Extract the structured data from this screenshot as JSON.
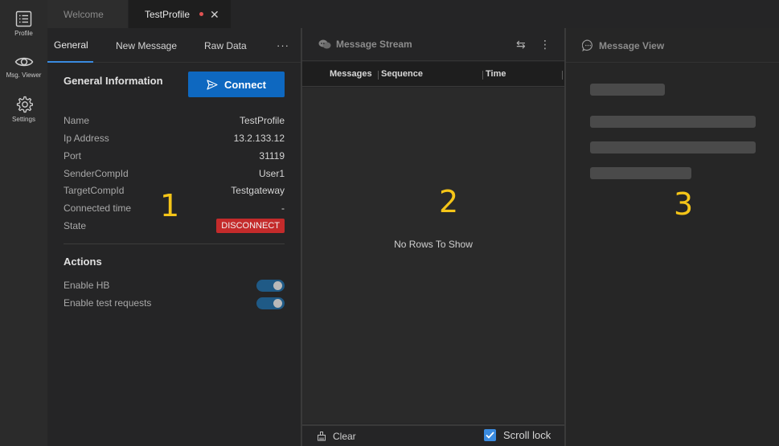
{
  "activity_bar": {
    "items": [
      {
        "label": "Profile",
        "icon": "list-icon"
      },
      {
        "label": "Msg. Viewer",
        "icon": "eye-icon"
      },
      {
        "label": "Settings",
        "icon": "gear-icon"
      }
    ]
  },
  "tabs": {
    "welcome": "Welcome",
    "active": "TestProfile"
  },
  "profile_panel": {
    "tabs": [
      "General",
      "New Message",
      "Raw Data",
      "···"
    ],
    "section_title": "General Information",
    "connect_label": "Connect",
    "fields": [
      {
        "key": "Name",
        "value": "TestProfile"
      },
      {
        "key": "Ip Address",
        "value": "13.2.133.12"
      },
      {
        "key": "Port",
        "value": "31119"
      },
      {
        "key": "SenderCompId",
        "value": "User1"
      },
      {
        "key": "TargetCompId",
        "value": "Testgateway"
      },
      {
        "key": "Connected time",
        "value": "-"
      },
      {
        "key": "State",
        "value": "DISCONNECT"
      }
    ],
    "actions_title": "Actions",
    "actions": [
      {
        "label": "Enable HB",
        "enabled": true
      },
      {
        "label": "Enable test requests",
        "enabled": true
      }
    ],
    "marker": "1"
  },
  "stream_panel": {
    "title": "Message Stream",
    "columns": [
      "Messages",
      "Sequence",
      "Time"
    ],
    "empty_text": "No Rows To Show",
    "clear_label": "Clear",
    "scroll_lock_label": "Scroll lock",
    "scroll_lock_checked": true,
    "marker": "2"
  },
  "view_panel": {
    "title": "Message View",
    "marker": "3"
  },
  "colors": {
    "accent": "#0e68c0",
    "danger": "#c42b2b",
    "marker": "#f5c518"
  }
}
